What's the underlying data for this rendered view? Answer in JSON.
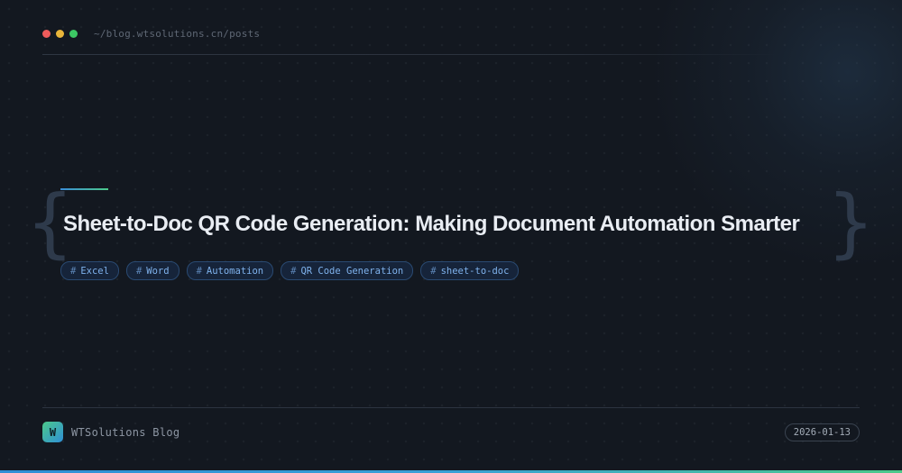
{
  "window": {
    "controls": [
      "close",
      "minimize",
      "maximize"
    ],
    "path": "~/blog.wtsolutions.cn/posts"
  },
  "post": {
    "title": "Sheet-to-Doc QR Code Generation: Making Document Automation Smarter",
    "tags": [
      {
        "hash": "#",
        "label": "Excel"
      },
      {
        "hash": "#",
        "label": "Word"
      },
      {
        "hash": "#",
        "label": "Automation"
      },
      {
        "hash": "#",
        "label": "QR Code Generation"
      },
      {
        "hash": "#",
        "label": "sheet-to-doc"
      }
    ]
  },
  "brackets": {
    "left": "{",
    "right": "}"
  },
  "footer": {
    "logo_letter": "W",
    "brand": "WTSolutions Blog",
    "date": "2026-01-13"
  },
  "colors": {
    "background": "#131820",
    "title": "#e9edf3",
    "tag_text": "#7fb2ec",
    "accent_blue": "#2f8fd6",
    "accent_green": "#4cc98a",
    "dot_red": "#ee5b5b",
    "dot_yellow": "#e8b53a",
    "dot_green": "#3cc864"
  },
  "icons": {
    "window_controls": [
      "red-dot-icon",
      "yellow-dot-icon",
      "green-dot-icon"
    ],
    "logo": "w-logo-icon"
  }
}
